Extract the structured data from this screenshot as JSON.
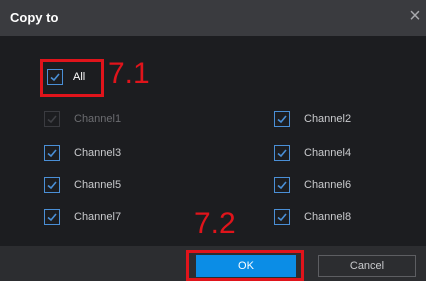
{
  "dialog": {
    "title": "Copy to",
    "close_glyph": "×"
  },
  "all_option": {
    "label": "All",
    "checked": true
  },
  "channels": [
    {
      "label": "Channel1",
      "checked": true,
      "disabled": true
    },
    {
      "label": "Channel2",
      "checked": true,
      "disabled": false
    },
    {
      "label": "Channel3",
      "checked": true,
      "disabled": false
    },
    {
      "label": "Channel4",
      "checked": true,
      "disabled": false
    },
    {
      "label": "Channel5",
      "checked": true,
      "disabled": false
    },
    {
      "label": "Channel6",
      "checked": true,
      "disabled": false
    },
    {
      "label": "Channel7",
      "checked": true,
      "disabled": false
    },
    {
      "label": "Channel8",
      "checked": true,
      "disabled": false
    }
  ],
  "buttons": {
    "ok": "OK",
    "cancel": "Cancel"
  },
  "annotations": {
    "step1": "7.1",
    "step2": "7.2"
  },
  "colors": {
    "accent": "#0b8de6",
    "checkbox_border": "#4a8fd6",
    "annotation": "#e0141b",
    "titlebar": "#3a3b3f",
    "body_bg": "#1c1d20"
  }
}
